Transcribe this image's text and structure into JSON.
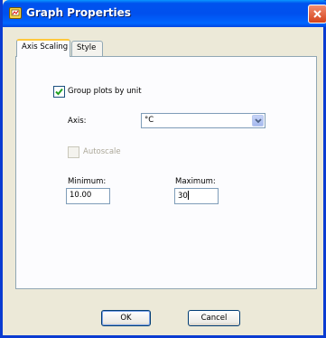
{
  "window": {
    "title": "Graph Properties"
  },
  "tabs": [
    {
      "label": "Axis Scaling",
      "active": true
    },
    {
      "label": "Style",
      "active": false
    }
  ],
  "group_by_unit": {
    "label": "Group plots by unit",
    "checked": true
  },
  "axis": {
    "label": "Axis:",
    "value": "°C"
  },
  "autoscale": {
    "label": "Autoscale",
    "checked": false,
    "enabled": false
  },
  "minimum": {
    "label": "Minimum:",
    "value": "10.00"
  },
  "maximum": {
    "label": "Maximum:",
    "value": "30"
  },
  "buttons": {
    "ok": "OK",
    "cancel": "Cancel"
  }
}
